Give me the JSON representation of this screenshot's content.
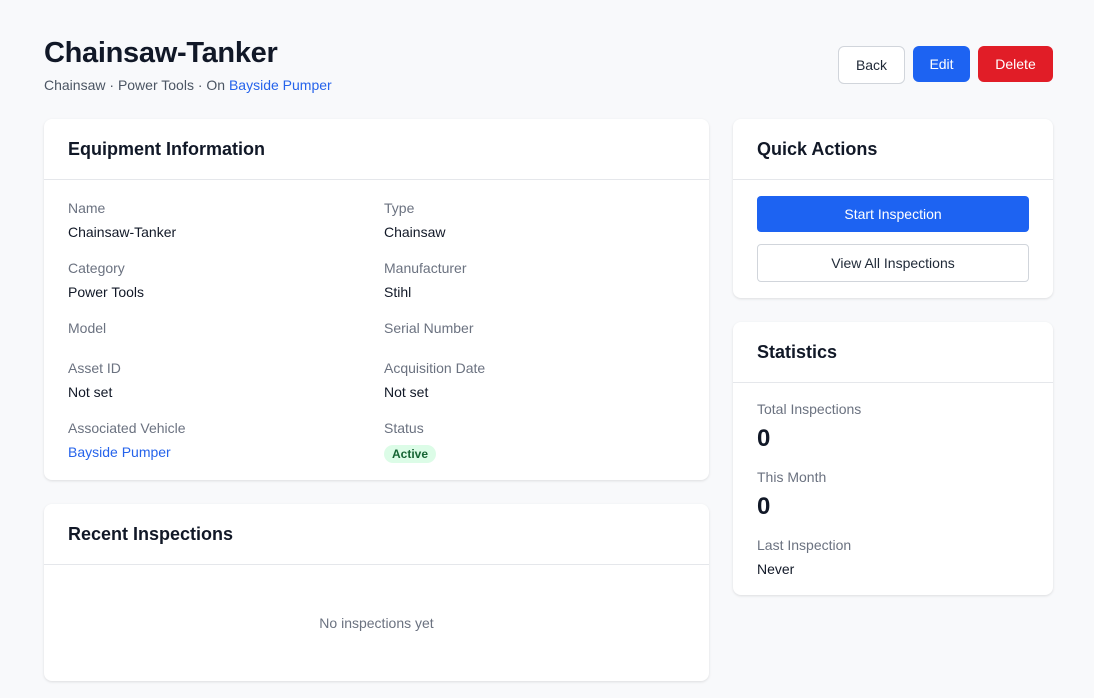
{
  "header": {
    "title": "Chainsaw-Tanker",
    "breadcrumb_type": "Chainsaw",
    "breadcrumb_sep1": " · ",
    "breadcrumb_category": "Power Tools",
    "breadcrumb_sep2": " · On ",
    "breadcrumb_vehicle": "Bayside Pumper",
    "back_label": "Back",
    "edit_label": "Edit",
    "delete_label": "Delete"
  },
  "equipment_info": {
    "title": "Equipment Information",
    "fields": [
      {
        "label": "Name",
        "value": "Chainsaw-Tanker"
      },
      {
        "label": "Type",
        "value": "Chainsaw"
      },
      {
        "label": "Category",
        "value": "Power Tools"
      },
      {
        "label": "Manufacturer",
        "value": "Stihl"
      },
      {
        "label": "Model",
        "value": ""
      },
      {
        "label": "Serial Number",
        "value": ""
      },
      {
        "label": "Asset ID",
        "value": "Not set"
      },
      {
        "label": "Acquisition Date",
        "value": "Not set"
      },
      {
        "label": "Associated Vehicle",
        "value": "Bayside Pumper"
      },
      {
        "label": "Status",
        "value": "Active"
      }
    ]
  },
  "recent_inspections": {
    "title": "Recent Inspections",
    "empty_text": "No inspections yet"
  },
  "quick_actions": {
    "title": "Quick Actions",
    "start_label": "Start Inspection",
    "view_all_label": "View All Inspections"
  },
  "statistics": {
    "title": "Statistics",
    "total_label": "Total Inspections",
    "total_value": "0",
    "month_label": "This Month",
    "month_value": "0",
    "last_label": "Last Inspection",
    "last_value": "Never"
  },
  "colors": {
    "primary": "#1d63f2",
    "danger": "#e11d27",
    "link": "#2563eb",
    "status_active_bg": "#dcfce7",
    "status_active_text": "#166534"
  }
}
